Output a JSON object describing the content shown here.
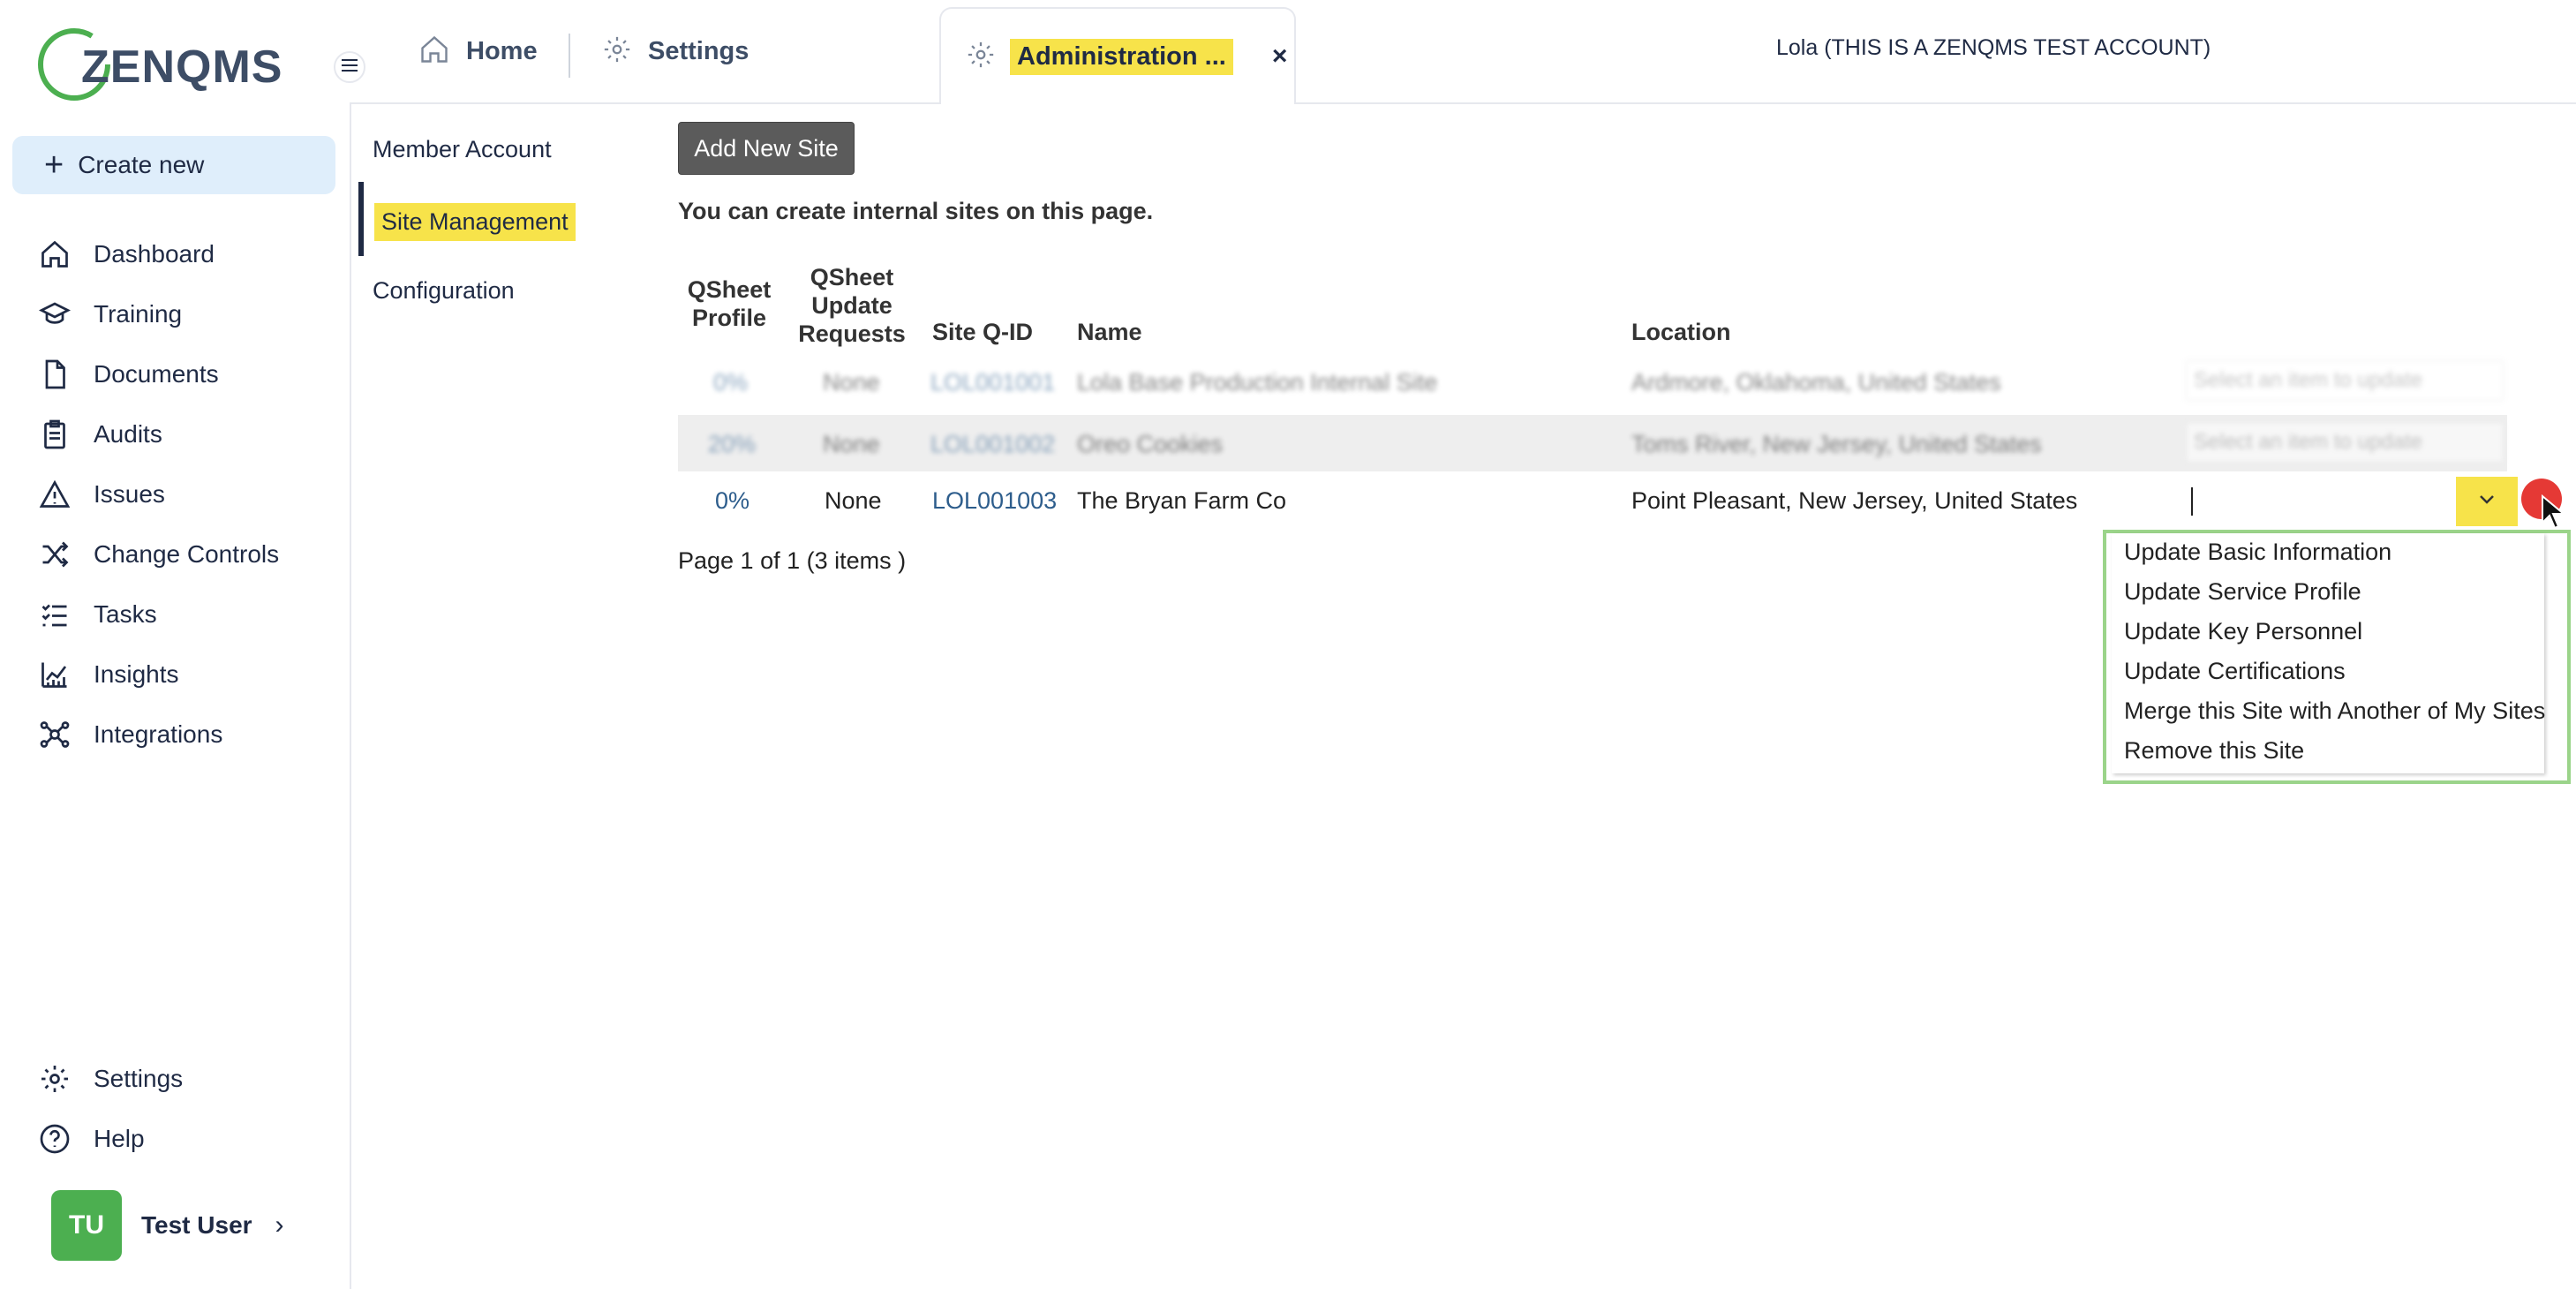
{
  "app": {
    "logo_text": "ZENQMS"
  },
  "sidebar": {
    "create_new": "Create new",
    "items": [
      {
        "label": "Dashboard",
        "icon": "home-icon"
      },
      {
        "label": "Training",
        "icon": "graduation-cap-icon"
      },
      {
        "label": "Documents",
        "icon": "document-icon"
      },
      {
        "label": "Audits",
        "icon": "clipboard-icon"
      },
      {
        "label": "Issues",
        "icon": "warning-icon"
      },
      {
        "label": "Change Controls",
        "icon": "shuffle-icon"
      },
      {
        "label": "Tasks",
        "icon": "tasks-icon"
      },
      {
        "label": "Insights",
        "icon": "chart-icon"
      },
      {
        "label": "Integrations",
        "icon": "network-icon"
      }
    ],
    "bottom": [
      {
        "label": "Settings",
        "icon": "gear-icon"
      },
      {
        "label": "Help",
        "icon": "help-icon"
      }
    ],
    "user": {
      "initials": "TU",
      "name": "Test User"
    }
  },
  "tabs": {
    "home": "Home",
    "settings": "Settings",
    "admin": "Administration ...",
    "close": "×"
  },
  "account_label": "Lola (THIS IS A ZENQMS TEST ACCOUNT)",
  "subnav": {
    "member_account": "Member Account",
    "site_management": "Site Management",
    "configuration": "Configuration"
  },
  "main": {
    "add_site": "Add New Site",
    "info": "You can create internal sites on this page.",
    "columns": {
      "qsheet_profile": [
        "QSheet",
        "Profile"
      ],
      "qsheet_update": [
        "QSheet",
        "Update",
        "Requests"
      ],
      "site_qid": "Site Q-ID",
      "name": "Name",
      "location": "Location"
    },
    "rows": [
      {
        "profile": "0%",
        "requests": "None",
        "qid": "LOL001001",
        "name": "Lola Base Production Internal Site",
        "location": "Ardmore, Oklahoma, United States",
        "select": "Select an item to update"
      },
      {
        "profile": "20%",
        "requests": "None",
        "qid": "LOL001002",
        "name": "Oreo Cookies",
        "location": "Toms River, New Jersey, United States",
        "select": "Select an item to update"
      },
      {
        "profile": "0%",
        "requests": "None",
        "qid": "LOL001003",
        "name": "The Bryan Farm Co",
        "location": "Point Pleasant, New Jersey, United States",
        "select": ""
      }
    ],
    "pager": "Page 1 of 1 (3 items )",
    "dropdown_options": [
      "Update Basic Information",
      "Update Service Profile",
      "Update Key Personnel",
      "Update Certifications",
      "Merge this Site with Another of My Sites",
      "Remove this Site"
    ]
  },
  "colors": {
    "highlight": "#f7e34a",
    "dropdown_border": "#9bd48a",
    "avatar": "#4caf50",
    "create_bg": "#dfeefb",
    "link": "#2d5d8c"
  }
}
